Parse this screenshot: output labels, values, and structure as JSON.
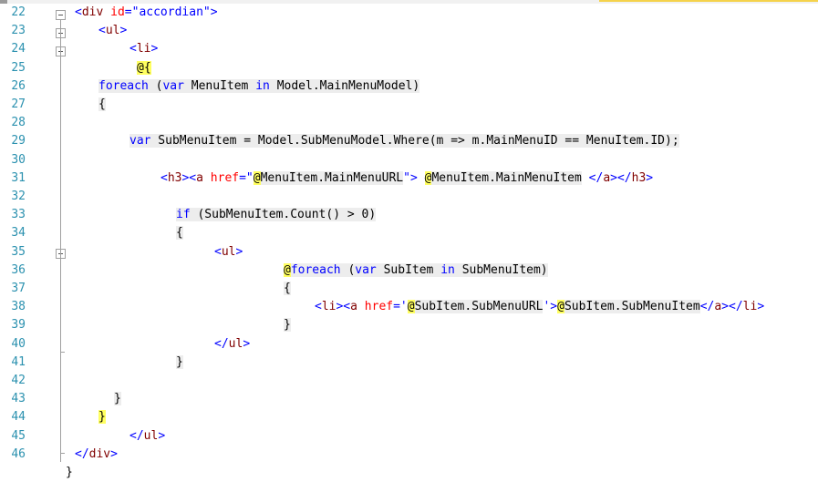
{
  "editor": {
    "lines": [
      {
        "num": "22",
        "segments": [
          {
            "t": "<",
            "c": "str"
          },
          {
            "t": "div",
            "c": "tag"
          },
          {
            "t": " ",
            "c": "plain"
          },
          {
            "t": "id",
            "c": "attr"
          },
          {
            "t": "=\"accordian\">",
            "c": "str"
          }
        ]
      },
      {
        "num": "23",
        "segments": [
          {
            "t": "<",
            "c": "str"
          },
          {
            "t": "ul",
            "c": "tag"
          },
          {
            "t": ">",
            "c": "str"
          }
        ]
      },
      {
        "num": "24",
        "segments": [
          {
            "t": "<",
            "c": "str"
          },
          {
            "t": "li",
            "c": "tag"
          },
          {
            "t": ">",
            "c": "str"
          }
        ]
      },
      {
        "num": "25",
        "segments": [
          {
            "t": "@{",
            "c": "razor"
          }
        ]
      },
      {
        "num": "26",
        "segments": [
          {
            "t": "foreach",
            "c": "kw csbg"
          },
          {
            "t": " (",
            "c": "plain csbg"
          },
          {
            "t": "var",
            "c": "kw csbg"
          },
          {
            "t": " MenuItem ",
            "c": "plain csbg"
          },
          {
            "t": "in",
            "c": "kw csbg"
          },
          {
            "t": " Model.MainMenuModel)",
            "c": "plain csbg"
          }
        ]
      },
      {
        "num": "27",
        "segments": [
          {
            "t": "{",
            "c": "plain csbg"
          }
        ]
      },
      {
        "num": "28",
        "segments": []
      },
      {
        "num": "29",
        "segments": [
          {
            "t": "var",
            "c": "kw csbg"
          },
          {
            "t": " SubMenuItem = Model.SubMenuModel.Where(m => m.MainMenuID == MenuItem.ID);",
            "c": "plain csbg"
          }
        ]
      },
      {
        "num": "30",
        "segments": []
      },
      {
        "num": "31",
        "segments": [
          {
            "t": "<",
            "c": "str"
          },
          {
            "t": "h3",
            "c": "tag"
          },
          {
            "t": "><",
            "c": "str"
          },
          {
            "t": "a",
            "c": "tag"
          },
          {
            "t": " ",
            "c": "plain"
          },
          {
            "t": "href",
            "c": "attr"
          },
          {
            "t": "=\"",
            "c": "str"
          },
          {
            "t": "@",
            "c": "razor"
          },
          {
            "t": "MenuItem.MainMenuURL",
            "c": "plain csbg"
          },
          {
            "t": "\">",
            "c": "str"
          },
          {
            "t": " ",
            "c": "plain"
          },
          {
            "t": "@",
            "c": "razor"
          },
          {
            "t": "MenuItem.MainMenuItem",
            "c": "plain csbg"
          },
          {
            "t": " </",
            "c": "str"
          },
          {
            "t": "a",
            "c": "tag"
          },
          {
            "t": "></",
            "c": "str"
          },
          {
            "t": "h3",
            "c": "tag"
          },
          {
            "t": ">",
            "c": "str"
          }
        ]
      },
      {
        "num": "32",
        "segments": []
      },
      {
        "num": "33",
        "segments": [
          {
            "t": "if",
            "c": "kw csbg"
          },
          {
            "t": " (SubMenuItem.Count() > 0)",
            "c": "plain csbg"
          }
        ]
      },
      {
        "num": "34",
        "segments": [
          {
            "t": "{",
            "c": "plain csbg"
          }
        ]
      },
      {
        "num": "35",
        "segments": [
          {
            "t": "<",
            "c": "str"
          },
          {
            "t": "ul",
            "c": "tag"
          },
          {
            "t": ">",
            "c": "str"
          }
        ]
      },
      {
        "num": "36",
        "segments": [
          {
            "t": "@",
            "c": "razor"
          },
          {
            "t": "foreach",
            "c": "kw csbg"
          },
          {
            "t": " (",
            "c": "plain csbg"
          },
          {
            "t": "var",
            "c": "kw csbg"
          },
          {
            "t": " SubItem ",
            "c": "plain csbg"
          },
          {
            "t": "in",
            "c": "kw csbg"
          },
          {
            "t": " SubMenuItem)",
            "c": "plain csbg"
          }
        ]
      },
      {
        "num": "37",
        "segments": [
          {
            "t": "{",
            "c": "plain csbg"
          }
        ]
      },
      {
        "num": "38",
        "segments": [
          {
            "t": "<",
            "c": "str"
          },
          {
            "t": "li",
            "c": "tag"
          },
          {
            "t": "><",
            "c": "str"
          },
          {
            "t": "a",
            "c": "tag"
          },
          {
            "t": " ",
            "c": "plain"
          },
          {
            "t": "href",
            "c": "attr"
          },
          {
            "t": "='",
            "c": "str"
          },
          {
            "t": "@",
            "c": "razor"
          },
          {
            "t": "SubItem.SubMenuURL",
            "c": "plain csbg"
          },
          {
            "t": "'>",
            "c": "str"
          },
          {
            "t": "@",
            "c": "razor"
          },
          {
            "t": "SubItem.SubMenuItem",
            "c": "plain csbg"
          },
          {
            "t": "</",
            "c": "str"
          },
          {
            "t": "a",
            "c": "tag"
          },
          {
            "t": "></",
            "c": "str"
          },
          {
            "t": "li",
            "c": "tag"
          },
          {
            "t": ">",
            "c": "str"
          }
        ]
      },
      {
        "num": "39",
        "segments": [
          {
            "t": "}",
            "c": "plain csbg"
          }
        ]
      },
      {
        "num": "40",
        "segments": [
          {
            "t": "</",
            "c": "str"
          },
          {
            "t": "ul",
            "c": "tag"
          },
          {
            "t": ">",
            "c": "str"
          }
        ]
      },
      {
        "num": "41",
        "segments": [
          {
            "t": "}",
            "c": "plain csbg"
          }
        ]
      },
      {
        "num": "42",
        "segments": []
      },
      {
        "num": "43",
        "segments": [
          {
            "t": "}",
            "c": "plain csbg"
          }
        ]
      },
      {
        "num": "44",
        "segments": [
          {
            "t": "}",
            "c": "razor"
          }
        ]
      },
      {
        "num": "45",
        "segments": [
          {
            "t": "</",
            "c": "str"
          },
          {
            "t": "ul",
            "c": "tag"
          },
          {
            "t": ">",
            "c": "str"
          }
        ]
      },
      {
        "num": "46",
        "segments": [
          {
            "t": "</",
            "c": "str"
          },
          {
            "t": "div",
            "c": "tag"
          },
          {
            "t": ">",
            "c": "str"
          }
        ]
      },
      {
        "num": "",
        "segments": [
          {
            "t": "}",
            "c": "plain"
          }
        ]
      }
    ]
  }
}
